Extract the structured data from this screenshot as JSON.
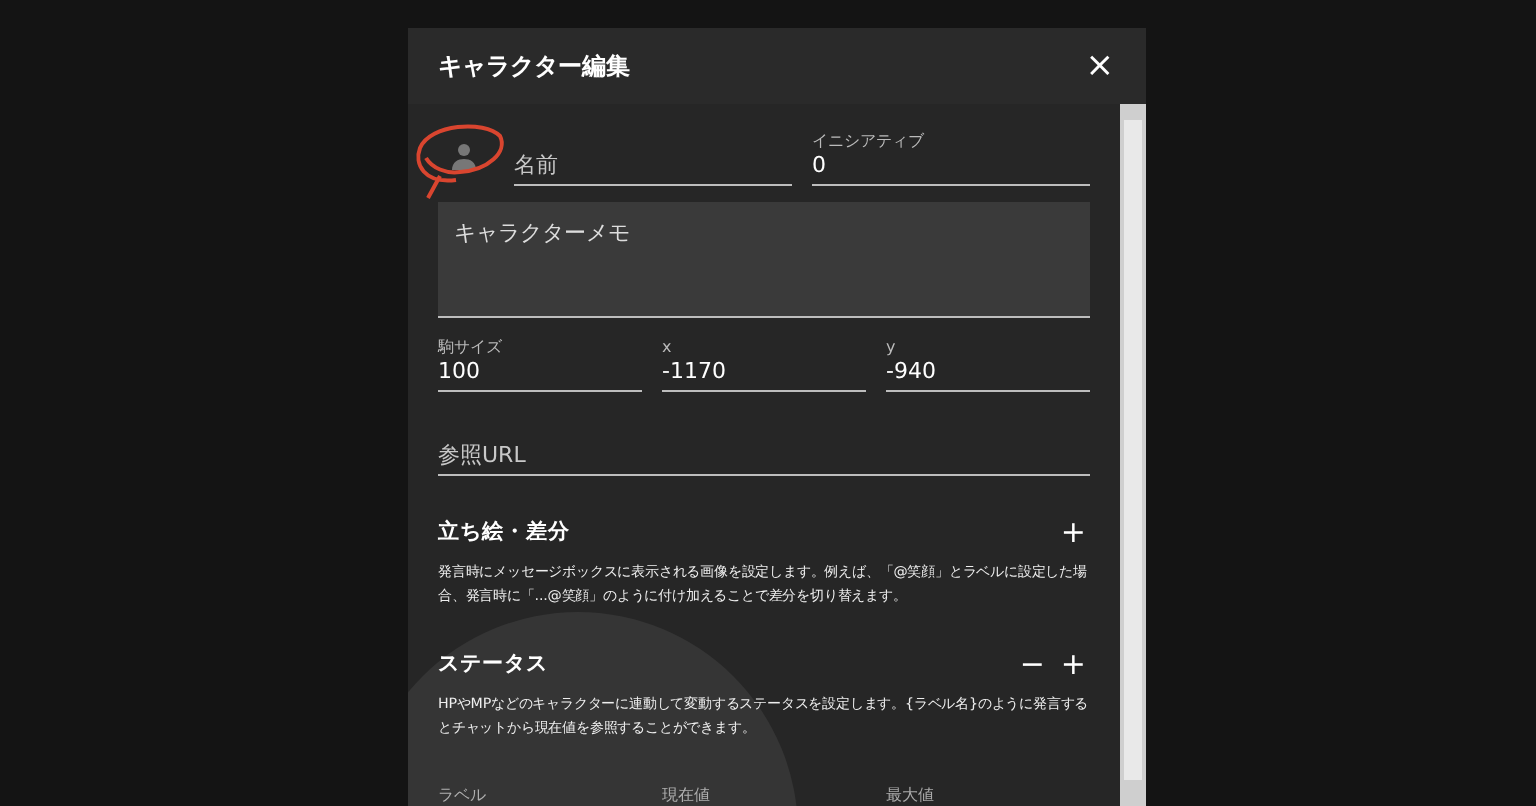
{
  "dialog": {
    "title": "キャラクター編集",
    "close": "×"
  },
  "top_fields": [
    {
      "kind": "placeholder",
      "text": "名前"
    },
    {
      "kind": "labeled",
      "label": "イニシアティブ",
      "value": "0"
    }
  ],
  "memo": {
    "placeholder": "キャラクターメモ"
  },
  "size_fields": [
    {
      "label": "駒サイズ",
      "value": "100"
    },
    {
      "label": "x",
      "value": "-1170"
    },
    {
      "label": "y",
      "value": "-940"
    }
  ],
  "url": {
    "placeholder": "参照URL"
  },
  "sections": [
    {
      "title": "立ち絵・差分",
      "actions": [
        "+"
      ],
      "description": "発言時にメッセージボックスに表示される画像を設定します。例えば、「@笑顔」とラベルに設定した場合、発言時に「...@笑顔」のように付け加えることで差分を切り替えます。"
    },
    {
      "title": "ステータス",
      "actions": [
        "−",
        "+"
      ],
      "description": "HPやMPなどのキャラクターに連動して変動するステータスを設定します。{ラベル名}のように発言するとチャットから現在値を参照することができます。"
    }
  ],
  "status_columns": [
    "ラベル",
    "現在値",
    "最大値"
  ]
}
